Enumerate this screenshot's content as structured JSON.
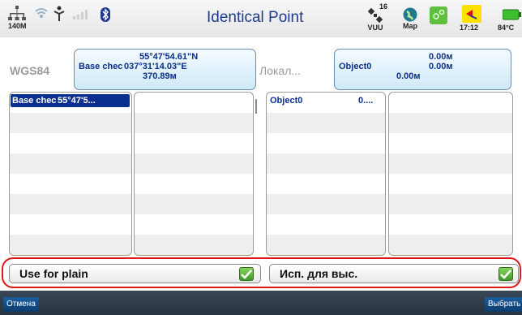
{
  "status": {
    "memory_label": "140M",
    "title": "Identical Point",
    "satellites": "16",
    "sat_label": "VUU",
    "map_label": "Map",
    "time": "17:12",
    "temperature": "84°C"
  },
  "coords": {
    "system_label": "WGS84",
    "local_label": "Локал...",
    "base": {
      "lat": "55°47'54.61\"N",
      "name": "Base chec",
      "lon": "037°31'14.03\"E",
      "height": "370.89м"
    },
    "object": {
      "name": "Object0",
      "north": "0.00м",
      "east": "0.00м",
      "height": "0.00м"
    }
  },
  "left_list": {
    "selected_name": "Base chec",
    "selected_value": "55°47'5..."
  },
  "right_list": {
    "name": "Object0",
    "value": "0...."
  },
  "options": {
    "plain_label": "Use for plain",
    "plain_checked": true,
    "height_label": "Исп. для выс.",
    "height_checked": true
  },
  "buttons": {
    "cancel": "Отмена",
    "select": "Выбрать"
  },
  "colors": {
    "title": "#1d3b8f",
    "selection": "#0a2f8f",
    "highlight": "#e01515",
    "check": "#3f9a2a"
  }
}
